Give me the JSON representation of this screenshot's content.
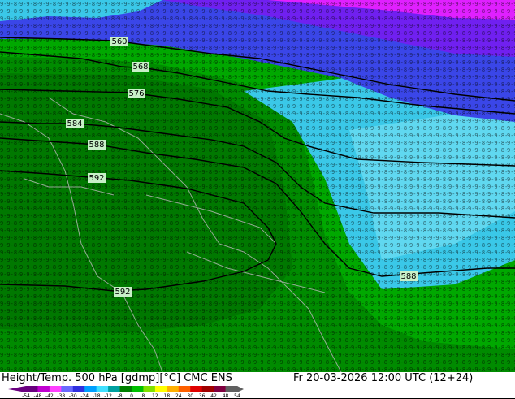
{
  "footer": {
    "title": "Height/Temp. 500 hPa [gdmp][°C] CMC ENS",
    "valid_time": "Fr 20-03-2026 12:00 UTC (12+24)"
  },
  "contour_labels": [
    "560",
    "568",
    "576",
    "584",
    "588",
    "592",
    "592",
    "588"
  ],
  "color_scale": {
    "ticks": [
      "-54",
      "-48",
      "-42",
      "-38",
      "-30",
      "-24",
      "-18",
      "-12",
      "-8",
      "0",
      "8",
      "12",
      "18",
      "24",
      "30",
      "36",
      "42",
      "48",
      "54"
    ],
    "colors": [
      "#6a0080",
      "#c000d0",
      "#ff40ff",
      "#6a6aff",
      "#3030e0",
      "#00a0ff",
      "#40e0ff",
      "#00a0a0",
      "#008000",
      "#00c000",
      "#80e000",
      "#ffff00",
      "#ffb000",
      "#ff6000",
      "#e00000",
      "#a00000",
      "#800040",
      "#606060"
    ]
  },
  "colors": {
    "dark_green": "#007a00",
    "green": "#00a800",
    "cyan": "#3ac8e8",
    "blue": "#3a46e8",
    "violet": "#7020f0",
    "magenta": "#e020ff",
    "contour": "#000000",
    "coast": "#b0b0b0"
  }
}
